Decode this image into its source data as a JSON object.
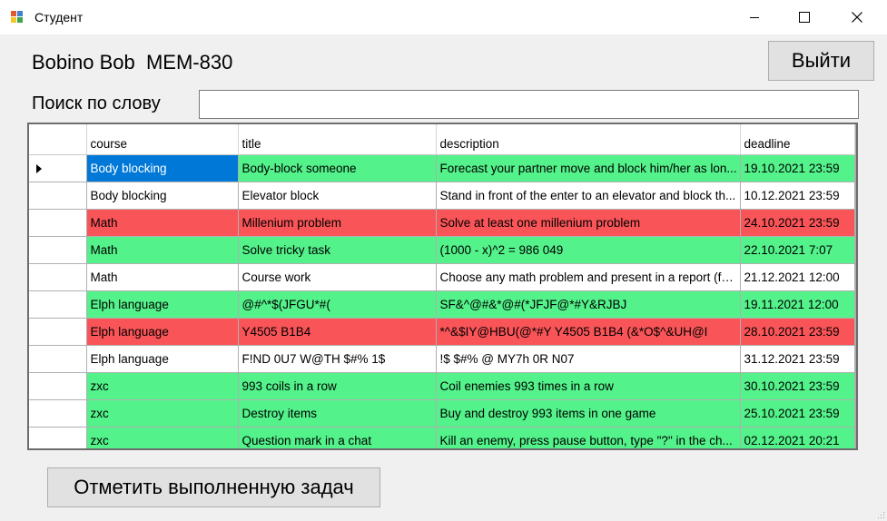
{
  "window": {
    "title": "Студент",
    "colors": {
      "green_row": "#53f28a",
      "red_row": "#f95457",
      "selection": "#0078d7"
    }
  },
  "header": {
    "user_label": "Bobino Bob  MEM-830",
    "exit_button": "Выйти"
  },
  "search": {
    "label": "Поиск по слову",
    "value": ""
  },
  "table": {
    "columns": [
      "course",
      "title",
      "description",
      "deadline"
    ],
    "rows": [
      {
        "status": "green",
        "course": "Body blocking",
        "title": "Body-block someone",
        "description": "Forecast your partner move and block him/her as lon...",
        "deadline": "19.10.2021 23:59"
      },
      {
        "status": "white",
        "course": "Body blocking",
        "title": "Elevator block",
        "description": "Stand in front of the enter to an elevator and block th...",
        "deadline": "10.12.2021 23:59"
      },
      {
        "status": "red",
        "course": "Math",
        "title": "Millenium problem",
        "description": "Solve at least one millenium problem",
        "deadline": "24.10.2021 23:59"
      },
      {
        "status": "green",
        "course": "Math",
        "title": "Solve tricky task",
        "description": "(1000 - x)^2 = 986 049",
        "deadline": "22.10.2021 7:07"
      },
      {
        "status": "white",
        "course": "Math",
        "title": "Course work",
        "description": "Choose any math problem and present in a report (foll...",
        "deadline": "21.12.2021 12:00"
      },
      {
        "status": "green",
        "course": "Elph language",
        "title": "@#^*$(JFGU*#(",
        "description": "SF&^@#&*@#(*JFJF@*#Y&RJBJ",
        "deadline": "19.11.2021 12:00"
      },
      {
        "status": "red",
        "course": "Elph language",
        "title": "Y4505 B1B4",
        "description": "*^&$IY@HBU(@*#Y Y4505 B1B4 (&*O$^&UH@I",
        "deadline": "28.10.2021 23:59"
      },
      {
        "status": "white",
        "course": "Elph language",
        "title": "F!ND 0U7 W@TH $#% 1$",
        "description": "!$ $#% @ MY7h 0R N07",
        "deadline": "31.12.2021 23:59"
      },
      {
        "status": "green",
        "course": "zxc",
        "title": "993 coils in a row",
        "description": "Coil enemies 993 times in a row",
        "deadline": "30.10.2021 23:59"
      },
      {
        "status": "green",
        "course": "zxc",
        "title": "Destroy items",
        "description": "Buy and destroy 993 items in one game",
        "deadline": "25.10.2021 23:59"
      },
      {
        "status": "green",
        "course": "zxc",
        "title": "Question mark in a chat",
        "description": "Kill an enemy, press pause button, type \"?\" in the ch...",
        "deadline": "02.12.2021 20:21"
      }
    ]
  },
  "footer": {
    "mark_done_button": "Отметить выполненную задач"
  }
}
